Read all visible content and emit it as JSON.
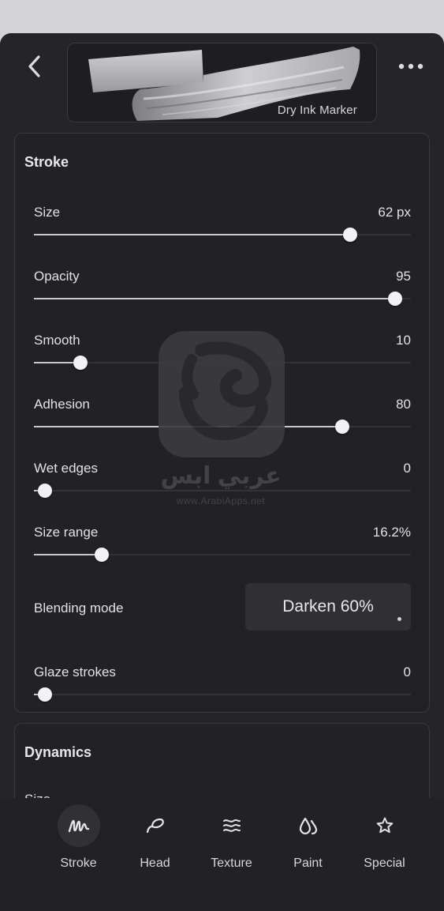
{
  "header": {
    "back_icon": "chevron-left-icon",
    "more_icon": "ellipsis-icon",
    "brush_name": "Dry Ink Marker"
  },
  "stroke_panel": {
    "title": "Stroke",
    "sliders": [
      {
        "label": "Size",
        "value": "62 px",
        "fraction": 0.82
      },
      {
        "label": "Opacity",
        "value": "95",
        "fraction": 0.94
      },
      {
        "label": "Smooth",
        "value": "10",
        "fraction": 0.105
      },
      {
        "label": "Adhesion",
        "value": "80",
        "fraction": 0.8
      },
      {
        "label": "Wet edges",
        "value": "0",
        "fraction": 0.01
      },
      {
        "label": "Size range",
        "value": "16.2%",
        "fraction": 0.162
      },
      {
        "label": "Glaze strokes",
        "value": "0",
        "fraction": 0.01
      }
    ],
    "blending": {
      "label": "Blending mode",
      "value": "Darken 60%"
    }
  },
  "dynamics_panel": {
    "title": "Dynamics",
    "first_item": "Size"
  },
  "watermark": {
    "arabic_text": "عربي ابس",
    "url": "www.ArabiApps.net"
  },
  "tabs": [
    {
      "label": "Stroke",
      "icon": "stroke-icon",
      "active": true
    },
    {
      "label": "Head",
      "icon": "head-icon",
      "active": false
    },
    {
      "label": "Texture",
      "icon": "texture-icon",
      "active": false
    },
    {
      "label": "Paint",
      "icon": "paint-drops-icon",
      "active": false
    },
    {
      "label": "Special",
      "icon": "star-icon",
      "active": false
    }
  ],
  "colors": {
    "background": "#252527",
    "panel": "#222224",
    "slider_fill": "#c9c9cc",
    "thumb": "#f2f2f4"
  }
}
